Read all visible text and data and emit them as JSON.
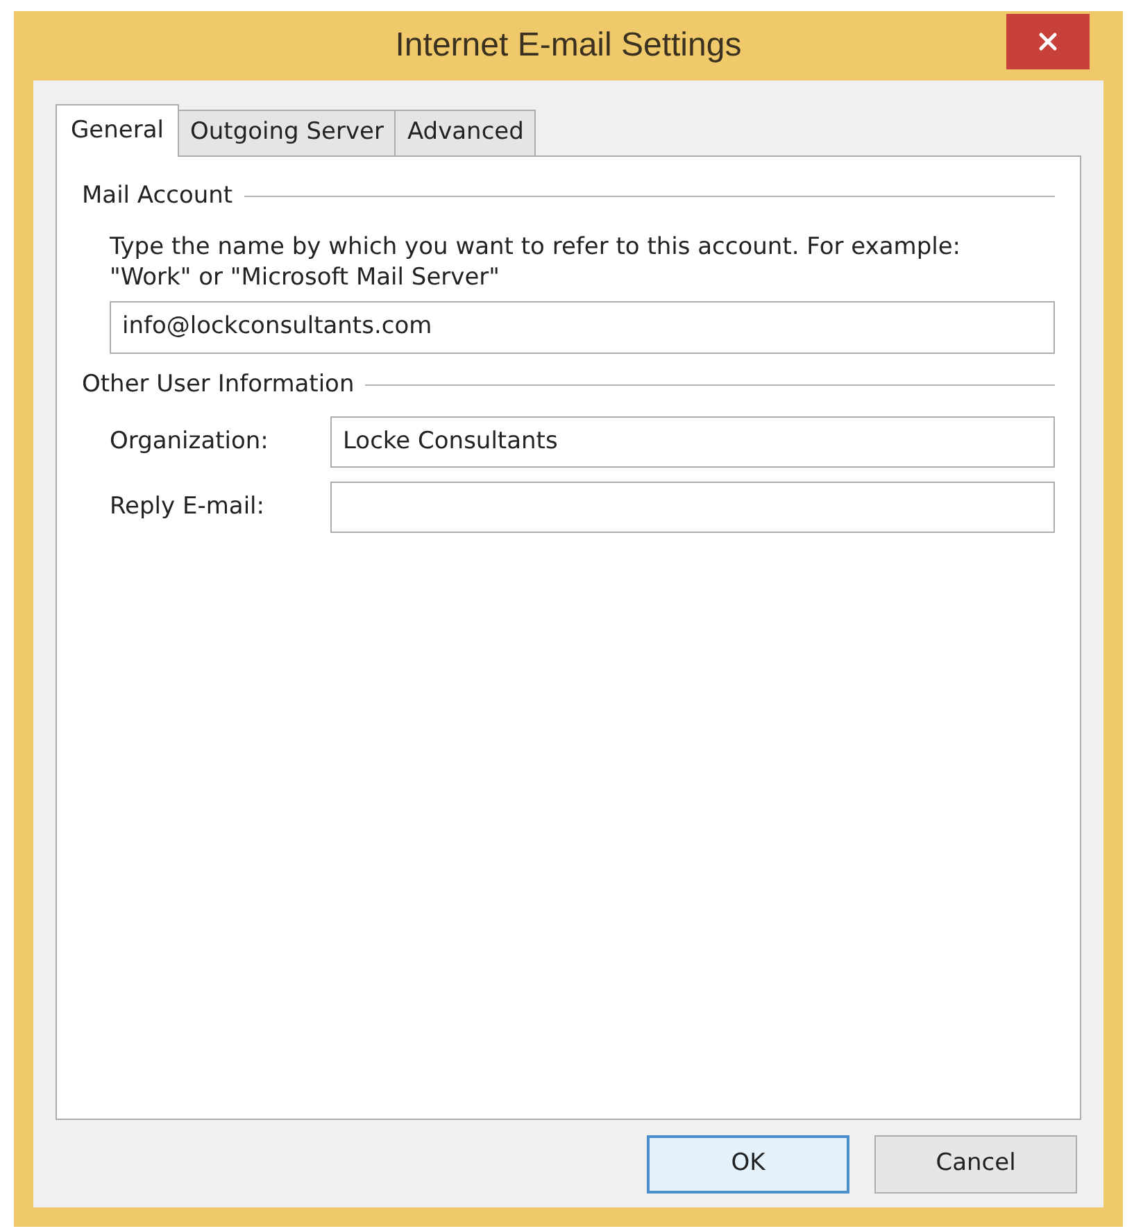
{
  "window": {
    "title": "Internet E-mail Settings"
  },
  "tabs": [
    {
      "label": "General",
      "selected": true
    },
    {
      "label": "Outgoing Server",
      "selected": false
    },
    {
      "label": "Advanced",
      "selected": false
    }
  ],
  "mail_account": {
    "heading": "Mail Account",
    "description": "Type the name by which you want to refer to this account. For example: \"Work\" or \"Microsoft Mail Server\"",
    "value": "info@lockconsultants.com"
  },
  "other_user_information": {
    "heading": "Other User Information",
    "fields": [
      {
        "label": "Organization:",
        "value": "Locke Consultants"
      },
      {
        "label": "Reply E-mail:"
      }
    ]
  },
  "buttons": [
    {
      "label": "OK",
      "default": true
    },
    {
      "label": "Cancel",
      "default": false
    }
  ]
}
